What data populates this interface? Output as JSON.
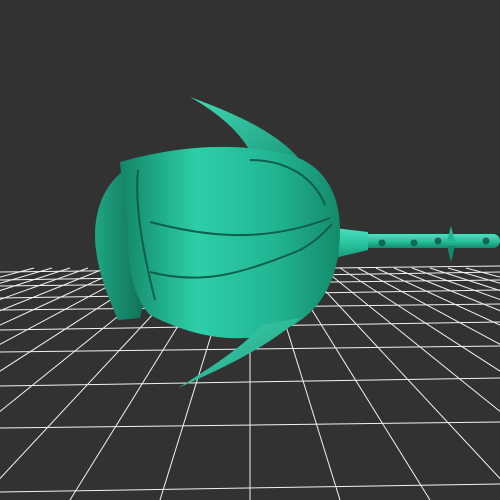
{
  "viewport": {
    "background_color": "#323232",
    "grid_color": "#f2f2f2",
    "model_color": "#27c4a0",
    "model_shadow_color": "#0f5f4c",
    "model_highlight_color": "#48dcbc"
  },
  "scene": {
    "object": "rose-bud-3d-model",
    "parts": [
      "bud",
      "sepal-top",
      "sepal-bottom",
      "stem",
      "thorns"
    ]
  }
}
